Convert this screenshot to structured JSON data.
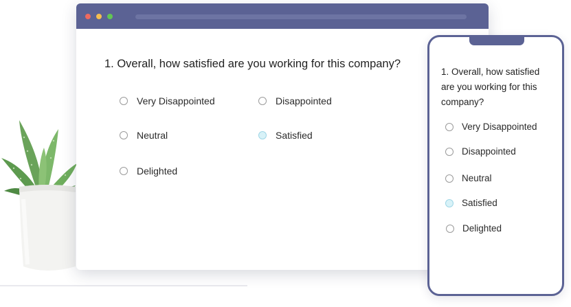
{
  "colors": {
    "frame": "#5b6294",
    "dot_red": "#ee6a5f",
    "dot_yellow": "#f5be4f",
    "dot_green": "#62c554",
    "selected_radio": "#d8f2f8"
  },
  "desktop": {
    "question": "1. Overall, how satisfied are you working for this company?",
    "options": [
      {
        "label": "Very Disappointed",
        "selected": false
      },
      {
        "label": "Disappointed",
        "selected": false
      },
      {
        "label": "Neutral",
        "selected": false
      },
      {
        "label": "Satisfied",
        "selected": true
      },
      {
        "label": "Delighted",
        "selected": false
      }
    ]
  },
  "mobile": {
    "question": "1. Overall, how satisfied are you working for this company?",
    "options": [
      {
        "label": "Very Disappointed",
        "selected": false
      },
      {
        "label": "Disappointed",
        "selected": false
      },
      {
        "label": "Neutral",
        "selected": false
      },
      {
        "label": "Satisfied",
        "selected": true
      },
      {
        "label": "Delighted",
        "selected": false
      }
    ]
  },
  "decor": {
    "plant_icon": "potted-succulent-icon"
  }
}
